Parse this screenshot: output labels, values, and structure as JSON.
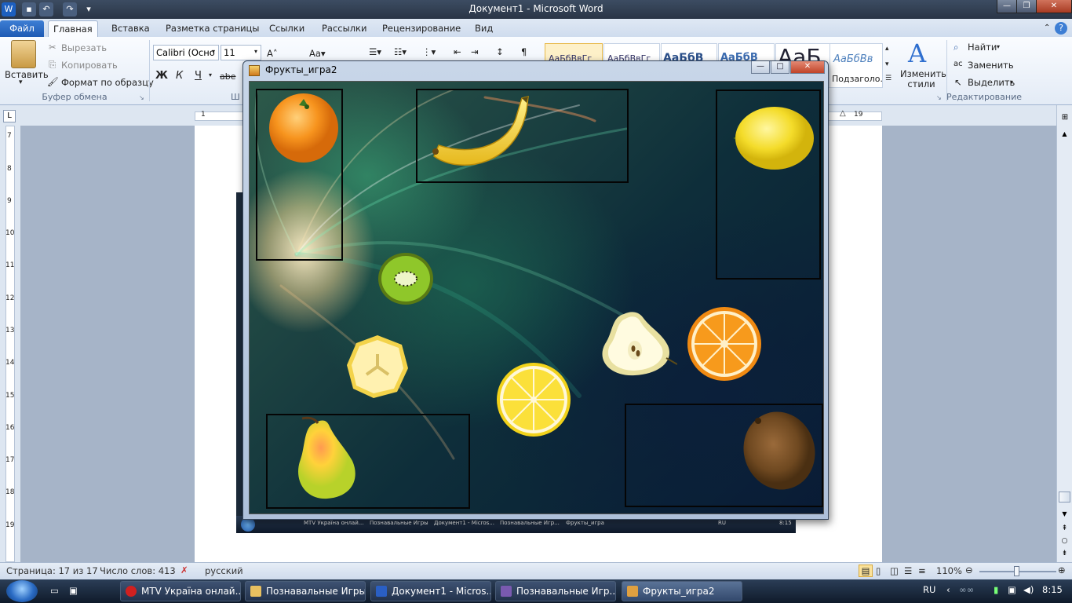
{
  "window": {
    "title": "Документ1  -  Microsoft Word"
  },
  "quick_access": [
    "save",
    "undo",
    "redo"
  ],
  "tabs": [
    "Файл",
    "Главная",
    "Вставка",
    "Разметка страницы",
    "Ссылки",
    "Рассылки",
    "Рецензирование",
    "Вид"
  ],
  "ribbon": {
    "paste": "Вставить",
    "cut": "Вырезать",
    "copy": "Копировать",
    "format_painter": "Формат по образцу",
    "clipboard_group": "Буфер обмена",
    "font_name": "Calibri (Осно",
    "font_size": "11",
    "bold": "Ж",
    "italic": "К",
    "underline": "Ч",
    "strike": "abe",
    "style_samples": [
      "АаБбВвГг",
      "АаБбВвГг",
      "АаБбВ",
      "АаБбВ",
      "АаБ",
      "АаБбВв"
    ],
    "style_caption": "Подзаголо...",
    "change_styles": "Изменить стили",
    "find": "Найти",
    "replace": "Заменить",
    "select": "Выделить",
    "edit_group": "Редактирование",
    "partial_group": "Ш"
  },
  "game": {
    "title": "Фрукты_игра2"
  },
  "embedded_taskbar": [
    "MTV Україна онлай...",
    "Познавальные Игры",
    "Документ1 - Micros...",
    "Познавальные Игр...",
    "Фрукты_игра"
  ],
  "embedded_tray": {
    "lang": "RU",
    "time": "8:15"
  },
  "status": {
    "page": "Страница: 17 из 17",
    "words": "Число слов: 413",
    "lang": "русский",
    "zoom": "110%"
  },
  "taskbar": {
    "items": [
      "MTV Україна онлай...",
      "Познавальные Игры",
      "Документ1 - Micros...",
      "Познавальные Игр...",
      "Фрукты_игра2"
    ],
    "lang": "RU",
    "time": "8:15"
  },
  "ruler": {
    "h_left": "1",
    "h_right": "19",
    "v": [
      "7",
      "8",
      "9",
      "10",
      "11",
      "12",
      "13",
      "14",
      "15",
      "16",
      "17",
      "18",
      "19"
    ]
  },
  "colors": {
    "word_tab": "#1f5bb4",
    "game_bg": "#0e2e3a"
  }
}
